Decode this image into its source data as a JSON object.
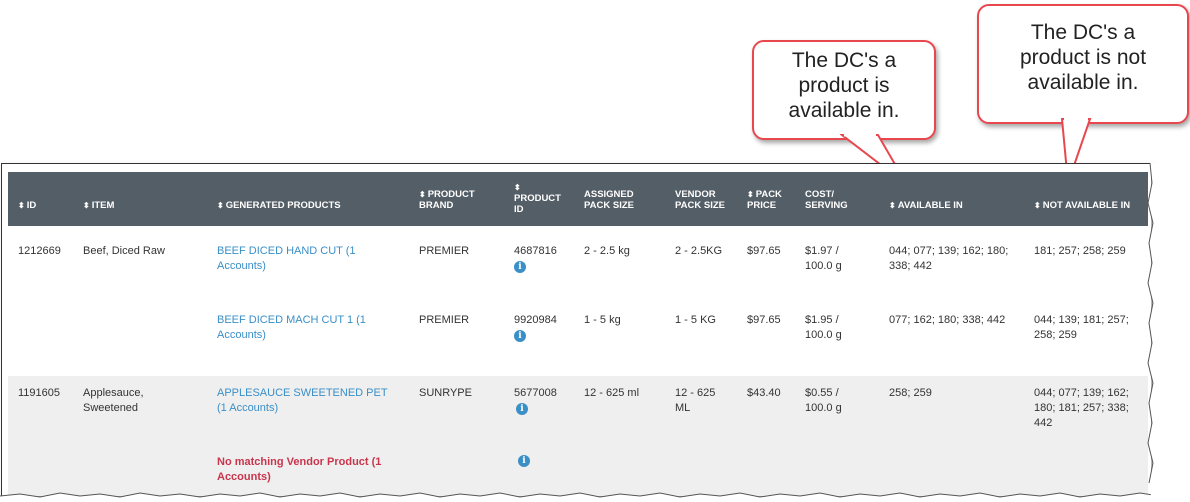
{
  "callouts": [
    {
      "text": "The DC's a product is available in."
    },
    {
      "text": "The DC's a product is not available in."
    }
  ],
  "table": {
    "columns": [
      {
        "label": "ID",
        "sortable": true
      },
      {
        "label": "ITEM",
        "sortable": true
      },
      {
        "label": "GENERATED PRODUCTS",
        "sortable": true
      },
      {
        "label": "PRODUCT BRAND",
        "sortable": true
      },
      {
        "label": "PRODUCT ID",
        "sortable": true
      },
      {
        "label": "ASSIGNED PACK SIZE",
        "sortable": false
      },
      {
        "label": "VENDOR PACK SIZE",
        "sortable": false
      },
      {
        "label": "PACK PRICE",
        "sortable": true
      },
      {
        "label": "COST/ SERVING",
        "sortable": false
      },
      {
        "label": "AVAILABLE IN",
        "sortable": true
      },
      {
        "label": "NOT AVAILABLE IN",
        "sortable": true
      }
    ],
    "groups": [
      {
        "id": "1212669",
        "item": "Beef, Diced Raw",
        "products": [
          {
            "name": "BEEF DICED HAND CUT (1 Accounts)",
            "brand": "PREMIER",
            "product_id": "4687816",
            "assigned_pack": "2 - 2.5 kg",
            "vendor_pack": "2 - 2.5KG",
            "price": "$97.65",
            "cost": "$1.97 / 100.0 g",
            "available": "044; 077; 139; 162; 180; 338; 442",
            "not_available": "181; 257; 258; 259"
          },
          {
            "name": "BEEF DICED MACH CUT 1 (1 Accounts)",
            "brand": "PREMIER",
            "product_id": "9920984",
            "assigned_pack": "1 - 5 kg",
            "vendor_pack": "1 - 5 KG",
            "price": "$97.65",
            "cost": "$1.95 / 100.0 g",
            "available": "077; 162; 180; 338; 442",
            "not_available": "044; 139; 181; 257; 258; 259"
          }
        ]
      },
      {
        "id": "1191605",
        "item": "Applesauce, Sweetened",
        "products": [
          {
            "name": "APPLESAUCE SWEETENED PET (1 Accounts)",
            "brand": "SUNRYPE",
            "product_id": "5677008",
            "assigned_pack": "12 - 625 ml",
            "vendor_pack": "12 - 625 ML",
            "price": "$43.40",
            "cost": "$0.55 / 100.0 g",
            "available": "258; 259",
            "not_available": "044; 077; 139; 162; 180; 181; 257; 338; 442"
          },
          {
            "name": "No matching Vendor Product (1 Accounts)"
          }
        ]
      }
    ]
  },
  "icons": {
    "sort": "sort-icon",
    "info": "info-icon"
  },
  "colors": {
    "header_bg": "#545e66",
    "link": "#3a8fc7",
    "no_match": "#c8354d",
    "callout_border": "#e8474e"
  }
}
